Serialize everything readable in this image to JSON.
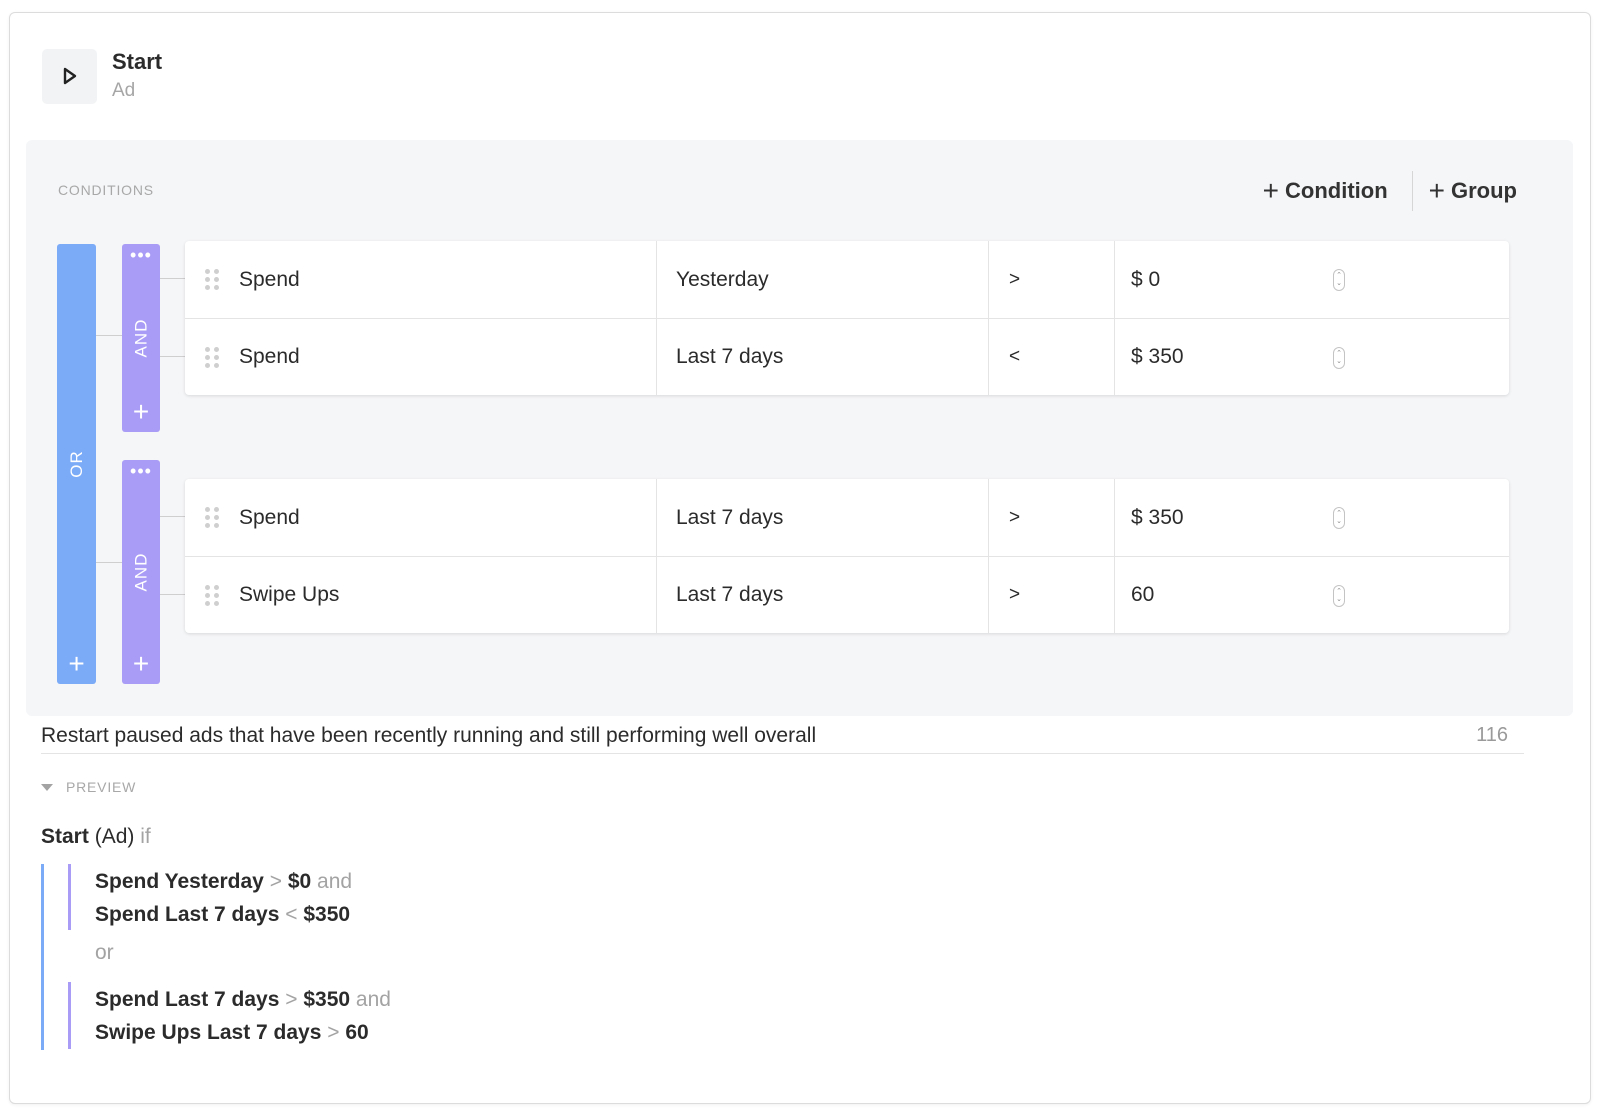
{
  "header": {
    "title": "Start",
    "subtitle": "Ad"
  },
  "conditions": {
    "section_label": "CONDITIONS",
    "add_condition_label": "Condition",
    "add_group_label": "Group",
    "or_label": "OR",
    "and_label": "AND",
    "groups": [
      {
        "rows": [
          {
            "metric": "Spend",
            "period": "Yesterday",
            "operator": ">",
            "value": "$ 0"
          },
          {
            "metric": "Spend",
            "period": "Last 7 days",
            "operator": "<",
            "value": "$ 350"
          }
        ]
      },
      {
        "rows": [
          {
            "metric": "Spend",
            "period": "Last 7 days",
            "operator": ">",
            "value": "$ 350"
          },
          {
            "metric": "Swipe Ups",
            "period": "Last 7 days",
            "operator": ">",
            "value": "60"
          }
        ]
      }
    ]
  },
  "description": {
    "text": "Restart paused ads that have been recently running and still performing well overall",
    "char_count": "116"
  },
  "preview": {
    "label": "PREVIEW",
    "action": "Start",
    "target": "(Ad)",
    "if_word": "if",
    "and_word": "and",
    "or_word": "or",
    "lines": [
      {
        "subject": "Spend Yesterday",
        "operator": ">",
        "value": "$0"
      },
      {
        "subject": "Spend Last 7 days",
        "operator": "<",
        "value": "$350"
      },
      {
        "subject": "Spend Last 7 days",
        "operator": ">",
        "value": "$350"
      },
      {
        "subject": "Swipe Ups Last 7 days",
        "operator": ">",
        "value": "60"
      }
    ]
  },
  "colors": {
    "or_bar": "#7baaf7",
    "and_bar": "#a99cf6",
    "panel_bg": "#f5f6f8"
  },
  "icons": {
    "start": "play-icon",
    "drag": "drag-handle-icon",
    "stepper": "stepper-icon",
    "more": "more-horizontal-icon",
    "add": "plus-icon",
    "collapse": "caret-down-icon"
  }
}
